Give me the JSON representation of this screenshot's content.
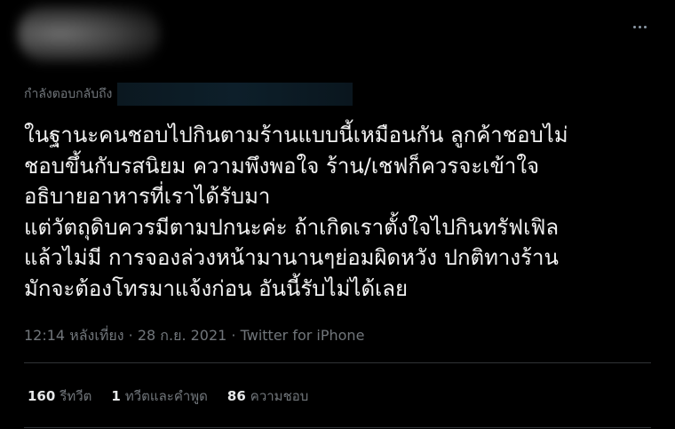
{
  "reply": {
    "prefix": "กำลังตอบกลับถึง"
  },
  "tweet": {
    "lines": [
      "ในฐานะคนชอบไปกินตามร้านแบบนี้เหมือนกัน ลูกค้าชอบไม่",
      "ชอบขึ้นกับรสนิยม ความพึงพอใจ ร้าน/เชฟก็ควรจะเข้าใจ",
      "อธิบายอาหารที่เราได้รับมา",
      "แต่วัตถุดิบควรมีตามปกนะค่ะ ถ้าเกิดเราตั้งใจไปกินทรัฟเฟิล",
      "แล้วไม่มี การจองล่วงหน้ามานานๆย่อมผิดหวัง ปกติทางร้าน",
      "มักจะต้องโทรมาแจ้งก่อน อันนี้รับไม่ได้เลย"
    ],
    "time": "12:14 หลังเที่ยง",
    "separator": "·",
    "date": "28 ก.ย. 2021",
    "source": "Twitter for iPhone"
  },
  "stats": {
    "retweets_count": "160",
    "retweets_label": "รีทวีต",
    "quotes_count": "1",
    "quotes_label": "ทวีตและคำพูด",
    "likes_count": "86",
    "likes_label": "ความชอบ"
  },
  "colors": {
    "background": "#000000",
    "text_primary": "#e7e9ea",
    "text_secondary": "#71767b",
    "divider": "#2f3336"
  }
}
